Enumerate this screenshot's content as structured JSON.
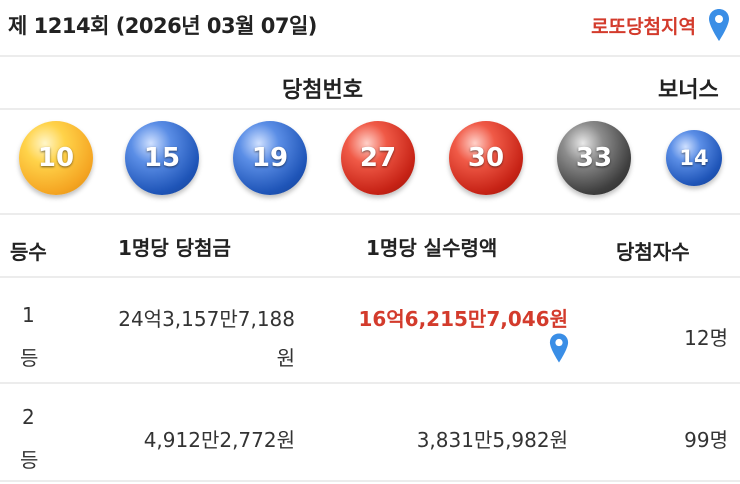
{
  "header": {
    "title": "제 1214회 (2026년 03월 07일)",
    "location_link": "로또당첨지역"
  },
  "numbers": {
    "label": "당첨번호",
    "bonus_label": "보너스",
    "balls": [
      {
        "value": "10",
        "color": "yellow"
      },
      {
        "value": "15",
        "color": "blue"
      },
      {
        "value": "19",
        "color": "blue"
      },
      {
        "value": "27",
        "color": "red"
      },
      {
        "value": "30",
        "color": "red"
      },
      {
        "value": "33",
        "color": "gray"
      }
    ],
    "bonus": {
      "value": "14",
      "color": "blue"
    }
  },
  "table": {
    "headers": [
      "등수",
      "1명당 당첨금",
      "1명당 실수령액",
      "당첨자수"
    ],
    "rows": [
      {
        "rank_num": "1",
        "rank_unit": "등",
        "prize_line1": "24억3,157만7,188",
        "prize_line2": "원",
        "net": "16억6,215만7,046원",
        "winners": "12명"
      },
      {
        "rank_num": "2",
        "rank_unit": "등",
        "prize": "4,912만2,772원",
        "net": "3,831만5,982원",
        "winners": "99명"
      }
    ]
  },
  "colors": {
    "accent_red": "#d33b2c",
    "pin_blue": "#3a8ee6"
  }
}
